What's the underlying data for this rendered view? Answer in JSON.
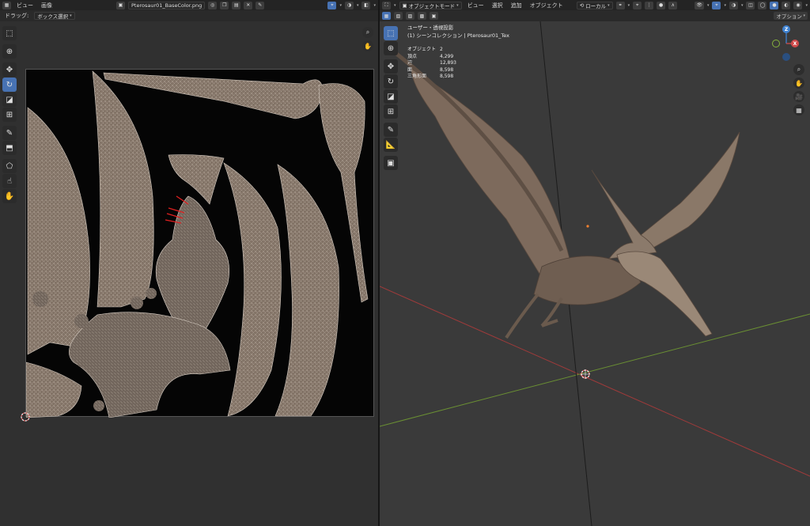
{
  "uv_editor": {
    "header": {
      "menu_view": "ビュー",
      "menu_image": "画像",
      "image_name": "Pterosaur01_BaseColor.png"
    },
    "subheader": {
      "drag_label": "ドラッグ:",
      "drag_mode": "ボックス選択"
    }
  },
  "viewport": {
    "header": {
      "mode": "オブジェクトモード",
      "menu_view": "ビュー",
      "menu_select": "選択",
      "menu_add": "追加",
      "menu_object": "オブジェクト",
      "orientation": "ローカル"
    },
    "subheader": {
      "options": "オプション"
    },
    "overlay": {
      "view_name": "ユーザー・透視投影",
      "collection": "(1) シーンコレクション | Pterosaur01_Tex",
      "stats": [
        {
          "label": "オブジェクト",
          "value": "2"
        },
        {
          "label": "頂点",
          "value": "4,299"
        },
        {
          "label": "辺",
          "value": "12,893"
        },
        {
          "label": "面",
          "value": "8,598"
        },
        {
          "label": "三角形面",
          "value": "8,598"
        }
      ]
    },
    "gizmo": {
      "x_label": "X",
      "y_label": "Y",
      "z_label": "Z"
    }
  },
  "colors": {
    "accent": "#4772b3",
    "axis_x": "#d04a4a",
    "axis_y": "#86b33c",
    "axis_z": "#3f82d1"
  }
}
